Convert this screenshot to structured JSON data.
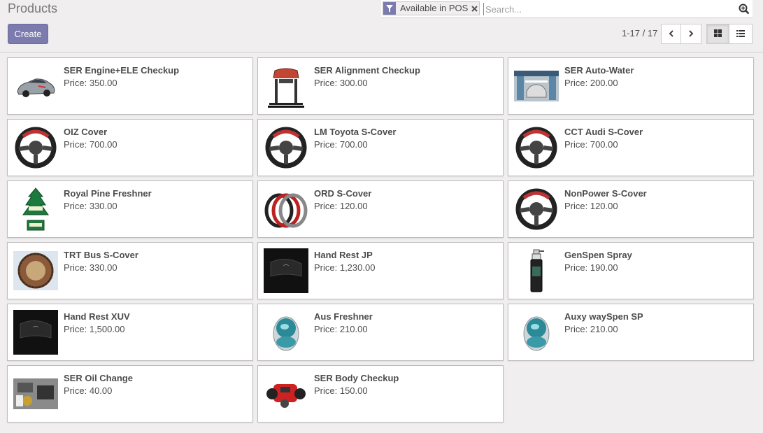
{
  "header": {
    "title": "Products",
    "create_label": "Create"
  },
  "search": {
    "facet_label": "Available in POS",
    "placeholder": "Search..."
  },
  "pager": {
    "value": "1-17 / 17"
  },
  "products": [
    {
      "name": "SER Engine+ELE Checkup",
      "price": "Price: 350.00",
      "icon": "car-icon"
    },
    {
      "name": "SER Alignment Checkup",
      "price": "Price: 300.00",
      "icon": "car-lift-icon"
    },
    {
      "name": "SER Auto-Water",
      "price": "Price: 200.00",
      "icon": "car-wash-icon"
    },
    {
      "name": "OIZ Cover",
      "price": "Price: 700.00",
      "icon": "steering-wheel-icon"
    },
    {
      "name": "LM Toyota S-Cover",
      "price": "Price: 700.00",
      "icon": "steering-wheel-icon"
    },
    {
      "name": "CCT Audi S-Cover",
      "price": "Price: 700.00",
      "icon": "steering-wheel-icon"
    },
    {
      "name": "Royal Pine Freshner",
      "price": "Price: 330.00",
      "icon": "tree-freshener-icon"
    },
    {
      "name": "ORD S-Cover",
      "price": "Price: 120.00",
      "icon": "wheel-covers-icon"
    },
    {
      "name": "NonPower S-Cover",
      "price": "Price: 120.00",
      "icon": "steering-wheel-icon"
    },
    {
      "name": "TRT Bus S-Cover",
      "price": "Price: 330.00",
      "icon": "bus-wheel-cover-icon"
    },
    {
      "name": "Hand Rest JP",
      "price": "Price: 1,230.00",
      "icon": "armrest-icon"
    },
    {
      "name": "GenSpen Spray",
      "price": "Price: 190.00",
      "icon": "spray-bottle-icon"
    },
    {
      "name": "Hand Rest XUV",
      "price": "Price: 1,500.00",
      "icon": "armrest-icon"
    },
    {
      "name": "Aus Freshner",
      "price": "Price: 210.00",
      "icon": "gel-freshener-icon"
    },
    {
      "name": "Auxy waySpen SP",
      "price": "Price: 210.00",
      "icon": "gel-freshener-icon"
    },
    {
      "name": "SER Oil Change",
      "price": "Price: 40.00",
      "icon": "engine-icon"
    },
    {
      "name": "SER Body Checkup",
      "price": "Price: 150.00",
      "icon": "car-parts-icon"
    }
  ],
  "colors": {
    "primary": "#7c7bad",
    "background": "#f0eeee",
    "text": "#4c4c4c"
  }
}
